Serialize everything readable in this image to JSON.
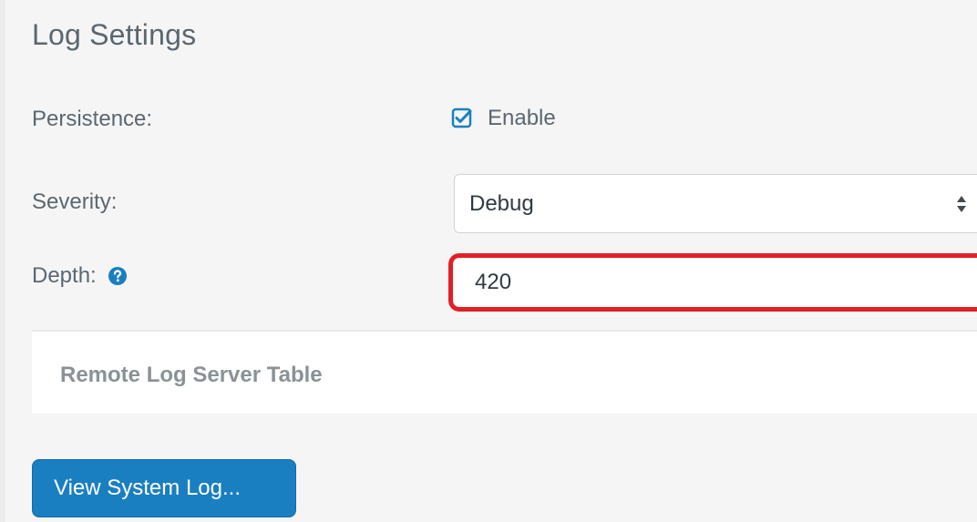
{
  "section": {
    "title": "Log Settings"
  },
  "persistence": {
    "label": "Persistence:",
    "checkbox_label": "Enable",
    "checked": true
  },
  "severity": {
    "label": "Severity:",
    "selected": "Debug"
  },
  "depth": {
    "label": "Depth:",
    "value": "420"
  },
  "remote_table": {
    "title": "Remote Log Server Table"
  },
  "actions": {
    "view_log_label": "View System Log..."
  },
  "colors": {
    "accent": "#1a7fc1",
    "highlight": "#e21f26",
    "label_text": "#5b6770"
  },
  "icons": {
    "checkbox": "checkbox-checked-icon",
    "help": "question-circle-icon",
    "select": "sort-arrows-icon"
  }
}
